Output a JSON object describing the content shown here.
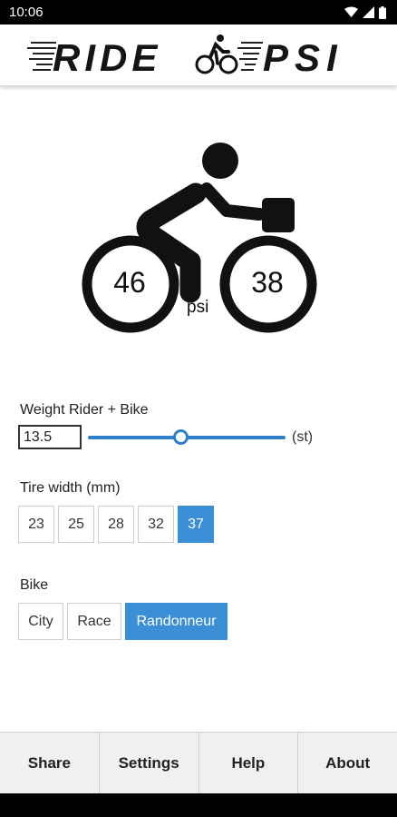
{
  "status_bar": {
    "time": "10:06"
  },
  "header": {
    "logo_text_left": "RIDE",
    "logo_text_right": "PSI"
  },
  "pressure": {
    "front": "46",
    "rear": "38",
    "unit": "psi"
  },
  "weight": {
    "label": "Weight Rider + Bike",
    "value": "13.5",
    "unit": "(st)",
    "slider_fraction": 0.47
  },
  "tire": {
    "label": "Tire width (mm)",
    "options": [
      "23",
      "25",
      "28",
      "32",
      "37"
    ],
    "selected": "37"
  },
  "bike": {
    "label": "Bike",
    "options": [
      "City",
      "Race",
      "Randonneur"
    ],
    "selected": "Randonneur"
  },
  "nav": {
    "items": [
      "Share",
      "Settings",
      "Help",
      "About"
    ]
  },
  "colors": {
    "accent": "#3a8fd6",
    "slider": "#2f7fc9"
  }
}
